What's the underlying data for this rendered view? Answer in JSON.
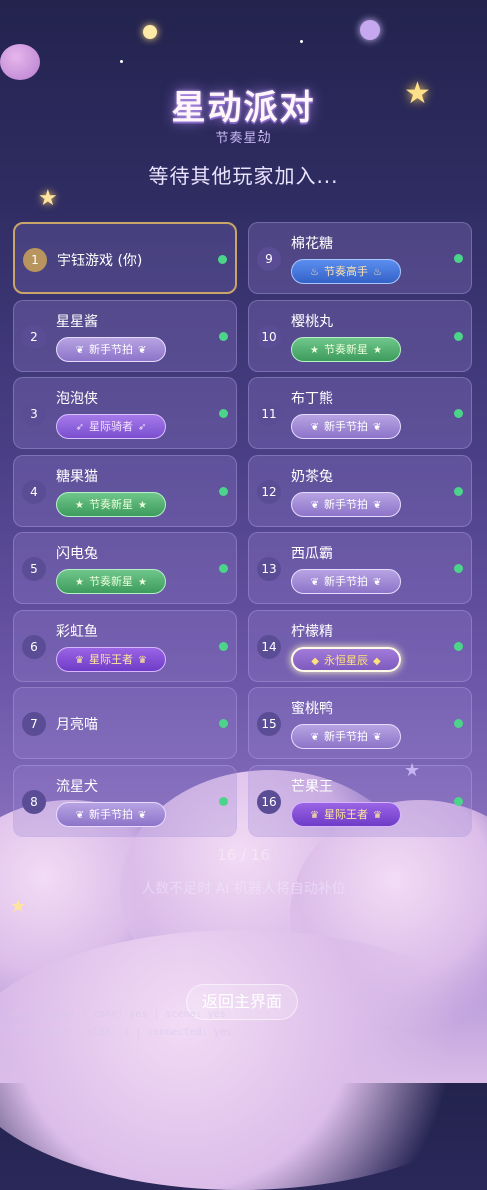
{
  "header": {
    "title": "星动派对",
    "subtitle": "节奏星动",
    "status": "等待其他玩家加入..."
  },
  "players": [
    {
      "num": "1",
      "name": "宇钰游戏 (你)",
      "badge": null,
      "is_self": true
    },
    {
      "num": "2",
      "name": "星星酱",
      "badge": {
        "label": "新手节拍",
        "style": "novice",
        "icon": "leaf-icon"
      }
    },
    {
      "num": "3",
      "name": "泡泡侠",
      "badge": {
        "label": "星际骑者",
        "style": "star-guard",
        "icon": "feather-icon"
      }
    },
    {
      "num": "4",
      "name": "糖果猫",
      "badge": {
        "label": "节奏新星",
        "style": "rhythm-star",
        "icon": "star-icon"
      }
    },
    {
      "num": "5",
      "name": "闪电兔",
      "badge": {
        "label": "节奏新星",
        "style": "rhythm-star",
        "icon": "star-icon"
      }
    },
    {
      "num": "6",
      "name": "彩虹鱼",
      "badge": {
        "label": "星际王者",
        "style": "star-king",
        "icon": "crown-icon"
      }
    },
    {
      "num": "7",
      "name": "月亮喵",
      "badge": null
    },
    {
      "num": "8",
      "name": "流星犬",
      "badge": {
        "label": "新手节拍",
        "style": "novice",
        "icon": "leaf-icon"
      }
    },
    {
      "num": "9",
      "name": "棉花糖",
      "badge": {
        "label": "节奏高手",
        "style": "master",
        "icon": "flame-icon"
      }
    },
    {
      "num": "10",
      "name": "樱桃丸",
      "badge": {
        "label": "节奏新星",
        "style": "rhythm-star",
        "icon": "star-icon"
      }
    },
    {
      "num": "11",
      "name": "布丁熊",
      "badge": {
        "label": "新手节拍",
        "style": "novice",
        "icon": "leaf-icon"
      }
    },
    {
      "num": "12",
      "name": "奶茶兔",
      "badge": {
        "label": "新手节拍",
        "style": "novice",
        "icon": "leaf-icon"
      }
    },
    {
      "num": "13",
      "name": "西瓜霸",
      "badge": {
        "label": "新手节拍",
        "style": "novice",
        "icon": "leaf-icon"
      }
    },
    {
      "num": "14",
      "name": "柠檬精",
      "badge": {
        "label": "永恒星辰",
        "style": "eternal",
        "icon": "gem-icon"
      }
    },
    {
      "num": "15",
      "name": "蜜桃鸭",
      "badge": {
        "label": "新手节拍",
        "style": "novice",
        "icon": "leaf-icon"
      }
    },
    {
      "num": "16",
      "name": "芒果王",
      "badge": {
        "label": "星际王者",
        "style": "star-king",
        "icon": "crown-icon"
      }
    }
  ],
  "footer": {
    "count": "16 / 16",
    "hint": "人数不足时 AI 机器人将自动补位",
    "back_label": "返回主界面",
    "debug_line1": "net: client | conn: yes | scene: yes",
    "debug_line2": "ready: yes | slot: 1 | connected: yes"
  },
  "colors": {
    "online": "#4cd58a",
    "self_border": "#c9a56a"
  }
}
